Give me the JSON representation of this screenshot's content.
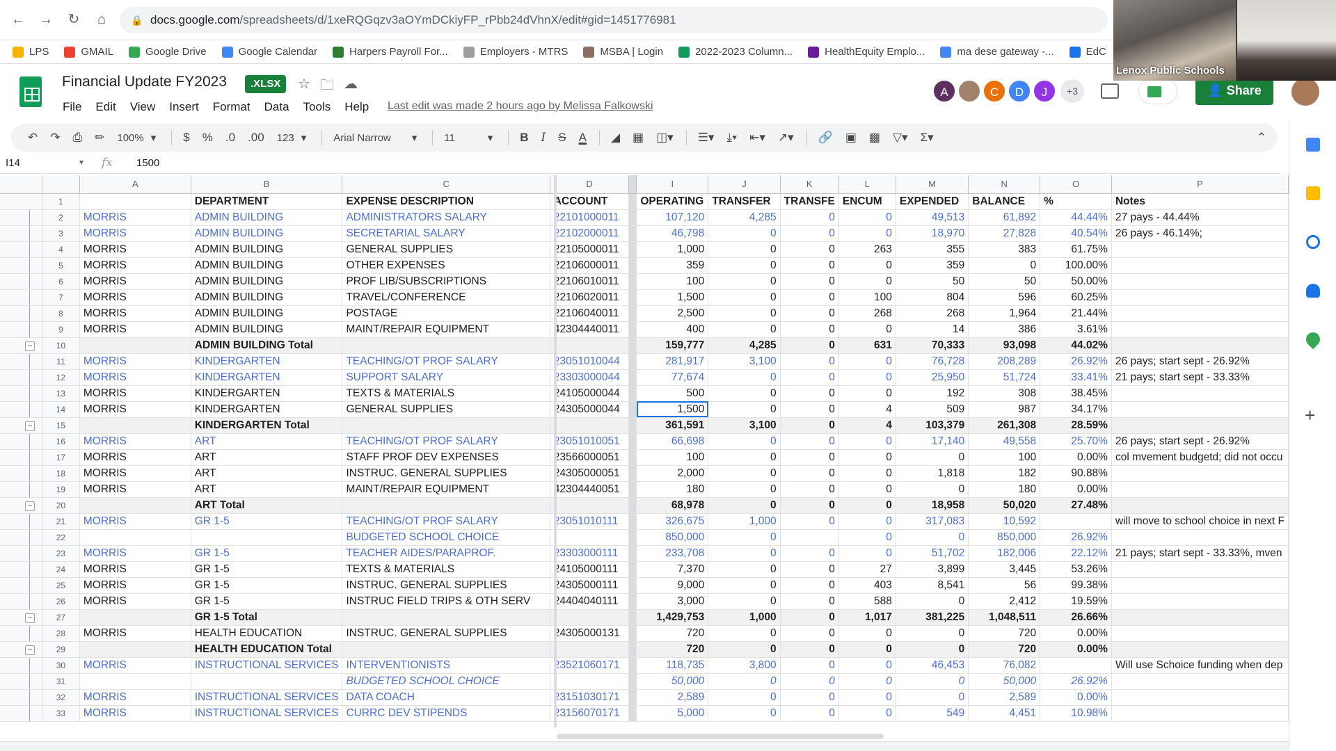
{
  "browser": {
    "url_host": "docs.google.com",
    "url_path": "/spreadsheets/d/1xeRQGqzv3aOYmDCkiyFP_rPbb24dVhnX/edit#gid=1451776981",
    "bookmarks": [
      {
        "label": "LPS",
        "color": "#f4b400"
      },
      {
        "label": "GMAIL",
        "color": "#ea4335"
      },
      {
        "label": "Google Drive",
        "color": "#34a853"
      },
      {
        "label": "Google Calendar",
        "color": "#4285f4"
      },
      {
        "label": "Harpers Payroll For...",
        "color": "#2e7d32"
      },
      {
        "label": "Employers - MTRS",
        "color": "#9e9e9e"
      },
      {
        "label": "MSBA | Login",
        "color": "#8d6e63"
      },
      {
        "label": "2022-2023 Column...",
        "color": "#0f9d58"
      },
      {
        "label": "HealthEquity Emplo...",
        "color": "#6a1b9a"
      },
      {
        "label": "ma dese gateway -...",
        "color": "#4285f4"
      },
      {
        "label": "EdC",
        "color": "#1a73e8"
      }
    ]
  },
  "doc": {
    "title": "Financial Update FY2023",
    "badge": ".XLSX",
    "last_edit": "Last edit was made 2 hours ago by Melissa Falkowski",
    "menu": [
      "File",
      "Edit",
      "View",
      "Insert",
      "Format",
      "Data",
      "Tools",
      "Help"
    ],
    "share_label": "Share",
    "collaborators": [
      {
        "initial": "A",
        "color": "#5f2f5f"
      },
      {
        "initial": "",
        "color": "#a0826d"
      },
      {
        "initial": "C",
        "color": "#e8710a"
      },
      {
        "initial": "D",
        "color": "#4285f4"
      },
      {
        "initial": "J",
        "color": "#9334e6"
      }
    ],
    "extra_collaborators": "+3"
  },
  "meeting": {
    "label": "Lenox Public Schools"
  },
  "toolbar": {
    "zoom": "100%",
    "currency": "$",
    "percent": "%",
    "dec_decrease": ".0",
    "dec_increase": ".00",
    "number_format": "123",
    "font": "Arial Narrow",
    "font_size": "11"
  },
  "formula": {
    "cell": "I14",
    "value": "1500"
  },
  "columns": [
    "A",
    "B",
    "C",
    "D",
    "",
    "I",
    "J",
    "K",
    "L",
    "M",
    "N",
    "O",
    "P"
  ],
  "rows": [
    {
      "n": "1",
      "type": "hdr",
      "cells": [
        "",
        "DEPARTMENT",
        "EXPENSE DESCRIPTION",
        "ACCOUNT",
        "OPERATING",
        "TRANSFER",
        "TRANSFE",
        "ENCUM",
        "EXPENDED",
        "BALANCE",
        "%",
        "Notes"
      ]
    },
    {
      "n": "2",
      "type": "blue",
      "cells": [
        "MORRIS",
        "ADMIN BUILDING",
        "ADMINISTRATORS SALARY",
        "22101000011",
        "107,120",
        "4,285",
        "0",
        "0",
        "49,513",
        "61,892",
        "44.44%",
        "27 pays - 44.44%"
      ]
    },
    {
      "n": "3",
      "type": "blue",
      "cells": [
        "MORRIS",
        "ADMIN BUILDING",
        "SECRETARIAL SALARY",
        "22102000011",
        "46,798",
        "0",
        "0",
        "0",
        "18,970",
        "27,828",
        "40.54%",
        "26 pays - 46.14%;"
      ]
    },
    {
      "n": "4",
      "type": "plain",
      "cells": [
        "MORRIS",
        "ADMIN BUILDING",
        "GENERAL SUPPLIES",
        "22105000011",
        "1,000",
        "0",
        "0",
        "263",
        "355",
        "383",
        "61.75%",
        ""
      ]
    },
    {
      "n": "5",
      "type": "plain",
      "cells": [
        "MORRIS",
        "ADMIN BUILDING",
        "OTHER EXPENSES",
        "22106000011",
        "359",
        "0",
        "0",
        "0",
        "359",
        "0",
        "100.00%",
        ""
      ]
    },
    {
      "n": "6",
      "type": "plain",
      "cells": [
        "MORRIS",
        "ADMIN BUILDING",
        "PROF LIB/SUBSCRIPTIONS",
        "22106010011",
        "100",
        "0",
        "0",
        "0",
        "50",
        "50",
        "50.00%",
        ""
      ]
    },
    {
      "n": "7",
      "type": "plain",
      "cells": [
        "MORRIS",
        "ADMIN BUILDING",
        "TRAVEL/CONFERENCE",
        "22106020011",
        "1,500",
        "0",
        "0",
        "100",
        "804",
        "596",
        "60.25%",
        ""
      ]
    },
    {
      "n": "8",
      "type": "plain",
      "cells": [
        "MORRIS",
        "ADMIN BUILDING",
        "POSTAGE",
        "22106040011",
        "2,500",
        "0",
        "0",
        "268",
        "268",
        "1,964",
        "21.44%",
        ""
      ]
    },
    {
      "n": "9",
      "type": "plain",
      "cells": [
        "MORRIS",
        "ADMIN BUILDING",
        "MAINT/REPAIR EQUIPMENT",
        "42304440011",
        "400",
        "0",
        "0",
        "0",
        "14",
        "386",
        "3.61%",
        ""
      ]
    },
    {
      "n": "10",
      "type": "total",
      "cells": [
        "",
        "ADMIN BUILDING Total",
        "",
        "",
        "159,777",
        "4,285",
        "0",
        "631",
        "70,333",
        "93,098",
        "44.02%",
        ""
      ]
    },
    {
      "n": "11",
      "type": "blue",
      "cells": [
        "MORRIS",
        "KINDERGARTEN",
        "TEACHING/OT PROF SALARY",
        "23051010044",
        "281,917",
        "3,100",
        "0",
        "0",
        "76,728",
        "208,289",
        "26.92%",
        "26 pays; start sept - 26.92%"
      ]
    },
    {
      "n": "12",
      "type": "blue",
      "cells": [
        "MORRIS",
        "KINDERGARTEN",
        "SUPPORT SALARY",
        "23303000044",
        "77,674",
        "0",
        "0",
        "0",
        "25,950",
        "51,724",
        "33.41%",
        "21 pays; start sept - 33.33%"
      ]
    },
    {
      "n": "13",
      "type": "plain",
      "cells": [
        "MORRIS",
        "KINDERGARTEN",
        "TEXTS & MATERIALS",
        "24105000044",
        "500",
        "0",
        "0",
        "0",
        "192",
        "308",
        "38.45%",
        ""
      ]
    },
    {
      "n": "14",
      "type": "plain",
      "cells": [
        "MORRIS",
        "KINDERGARTEN",
        "GENERAL SUPPLIES",
        "24305000044",
        "1,500",
        "0",
        "0",
        "4",
        "509",
        "987",
        "34.17%",
        ""
      ]
    },
    {
      "n": "15",
      "type": "total",
      "cells": [
        "",
        "KINDERGARTEN Total",
        "",
        "",
        "361,591",
        "3,100",
        "0",
        "4",
        "103,379",
        "261,308",
        "28.59%",
        ""
      ]
    },
    {
      "n": "16",
      "type": "blue",
      "cells": [
        "MORRIS",
        "ART",
        "TEACHING/OT PROF SALARY",
        "23051010051",
        "66,698",
        "0",
        "0",
        "0",
        "17,140",
        "49,558",
        "25.70%",
        "26 pays; start sept - 26.92%"
      ]
    },
    {
      "n": "17",
      "type": "plain",
      "cells": [
        "MORRIS",
        "ART",
        "STAFF PROF DEV EXPENSES",
        "23566000051",
        "100",
        "0",
        "0",
        "0",
        "0",
        "100",
        "0.00%",
        "col mvement budgetd; did not occu"
      ]
    },
    {
      "n": "18",
      "type": "plain",
      "cells": [
        "MORRIS",
        "ART",
        "INSTRUC. GENERAL SUPPLIES",
        "24305000051",
        "2,000",
        "0",
        "0",
        "0",
        "1,818",
        "182",
        "90.88%",
        ""
      ]
    },
    {
      "n": "19",
      "type": "plain",
      "cells": [
        "MORRIS",
        "ART",
        "MAINT/REPAIR EQUIPMENT",
        "42304440051",
        "180",
        "0",
        "0",
        "0",
        "0",
        "180",
        "0.00%",
        ""
      ]
    },
    {
      "n": "20",
      "type": "total",
      "cells": [
        "",
        "ART Total",
        "",
        "",
        "68,978",
        "0",
        "0",
        "0",
        "18,958",
        "50,020",
        "27.48%",
        ""
      ]
    },
    {
      "n": "21",
      "type": "blue",
      "cells": [
        "MORRIS",
        "GR 1-5",
        "TEACHING/OT PROF SALARY",
        "23051010111",
        "326,675",
        "1,000",
        "0",
        "0",
        "317,083",
        "10,592",
        "",
        "will move to school choice in next F"
      ]
    },
    {
      "n": "22",
      "type": "blue",
      "cells": [
        "",
        "",
        "BUDGETED SCHOOL CHOICE",
        "",
        "850,000",
        "0",
        "",
        "0",
        "0",
        "850,000",
        "26.92%",
        ""
      ]
    },
    {
      "n": "23",
      "type": "blue",
      "cells": [
        "MORRIS",
        "GR 1-5",
        "TEACHER AIDES/PARAPROF.",
        "23303000111",
        "233,708",
        "0",
        "0",
        "0",
        "51,702",
        "182,006",
        "22.12%",
        "21 pays; start sept - 33.33%, mven"
      ]
    },
    {
      "n": "24",
      "type": "plain",
      "cells": [
        "MORRIS",
        "GR 1-5",
        "TEXTS & MATERIALS",
        "24105000111",
        "7,370",
        "0",
        "0",
        "27",
        "3,899",
        "3,445",
        "53.26%",
        ""
      ]
    },
    {
      "n": "25",
      "type": "plain",
      "cells": [
        "MORRIS",
        "GR 1-5",
        "INSTRUC. GENERAL SUPPLIES",
        "24305000111",
        "9,000",
        "0",
        "0",
        "403",
        "8,541",
        "56",
        "99.38%",
        ""
      ]
    },
    {
      "n": "26",
      "type": "plain",
      "cells": [
        "MORRIS",
        "GR 1-5",
        "INSTRUC FIELD TRIPS & OTH SERV",
        "24404040111",
        "3,000",
        "0",
        "0",
        "588",
        "0",
        "2,412",
        "19.59%",
        ""
      ]
    },
    {
      "n": "27",
      "type": "total",
      "cells": [
        "",
        "GR 1-5 Total",
        "",
        "",
        "1,429,753",
        "1,000",
        "0",
        "1,017",
        "381,225",
        "1,048,511",
        "26.66%",
        ""
      ]
    },
    {
      "n": "28",
      "type": "plain",
      "cells": [
        "MORRIS",
        "HEALTH EDUCATION",
        "INSTRUC. GENERAL SUPPLIES",
        "24305000131",
        "720",
        "0",
        "0",
        "0",
        "0",
        "720",
        "0.00%",
        ""
      ]
    },
    {
      "n": "29",
      "type": "total",
      "cells": [
        "",
        "HEALTH EDUCATION Total",
        "",
        "",
        "720",
        "0",
        "0",
        "0",
        "0",
        "720",
        "0.00%",
        ""
      ]
    },
    {
      "n": "30",
      "type": "blue",
      "cells": [
        "MORRIS",
        "INSTRUCTIONAL SERVICES",
        "INTERVENTIONISTS",
        "23521060171",
        "118,735",
        "3,800",
        "0",
        "0",
        "46,453",
        "76,082",
        "",
        "Will use Schoice funding when dep"
      ]
    },
    {
      "n": "31",
      "type": "blue italic",
      "cells": [
        "",
        "",
        "BUDGETED SCHOOL CHOICE",
        "",
        "50,000",
        "0",
        "0",
        "0",
        "0",
        "50,000",
        "26.92%",
        ""
      ]
    },
    {
      "n": "32",
      "type": "blue",
      "cells": [
        "MORRIS",
        "INSTRUCTIONAL SERVICES",
        "DATA COACH",
        "23151030171",
        "2,589",
        "0",
        "0",
        "0",
        "0",
        "2,589",
        "0.00%",
        ""
      ]
    },
    {
      "n": "33",
      "type": "blue",
      "cells": [
        "MORRIS",
        "INSTRUCTIONAL SERVICES",
        "CURRC DEV STIPENDS",
        "23156070171",
        "5,000",
        "0",
        "0",
        "0",
        "549",
        "4,451",
        "10.98%",
        ""
      ]
    }
  ],
  "collapsed_rows": [
    "10",
    "15",
    "20",
    "27",
    "29"
  ],
  "selected_row": "14"
}
